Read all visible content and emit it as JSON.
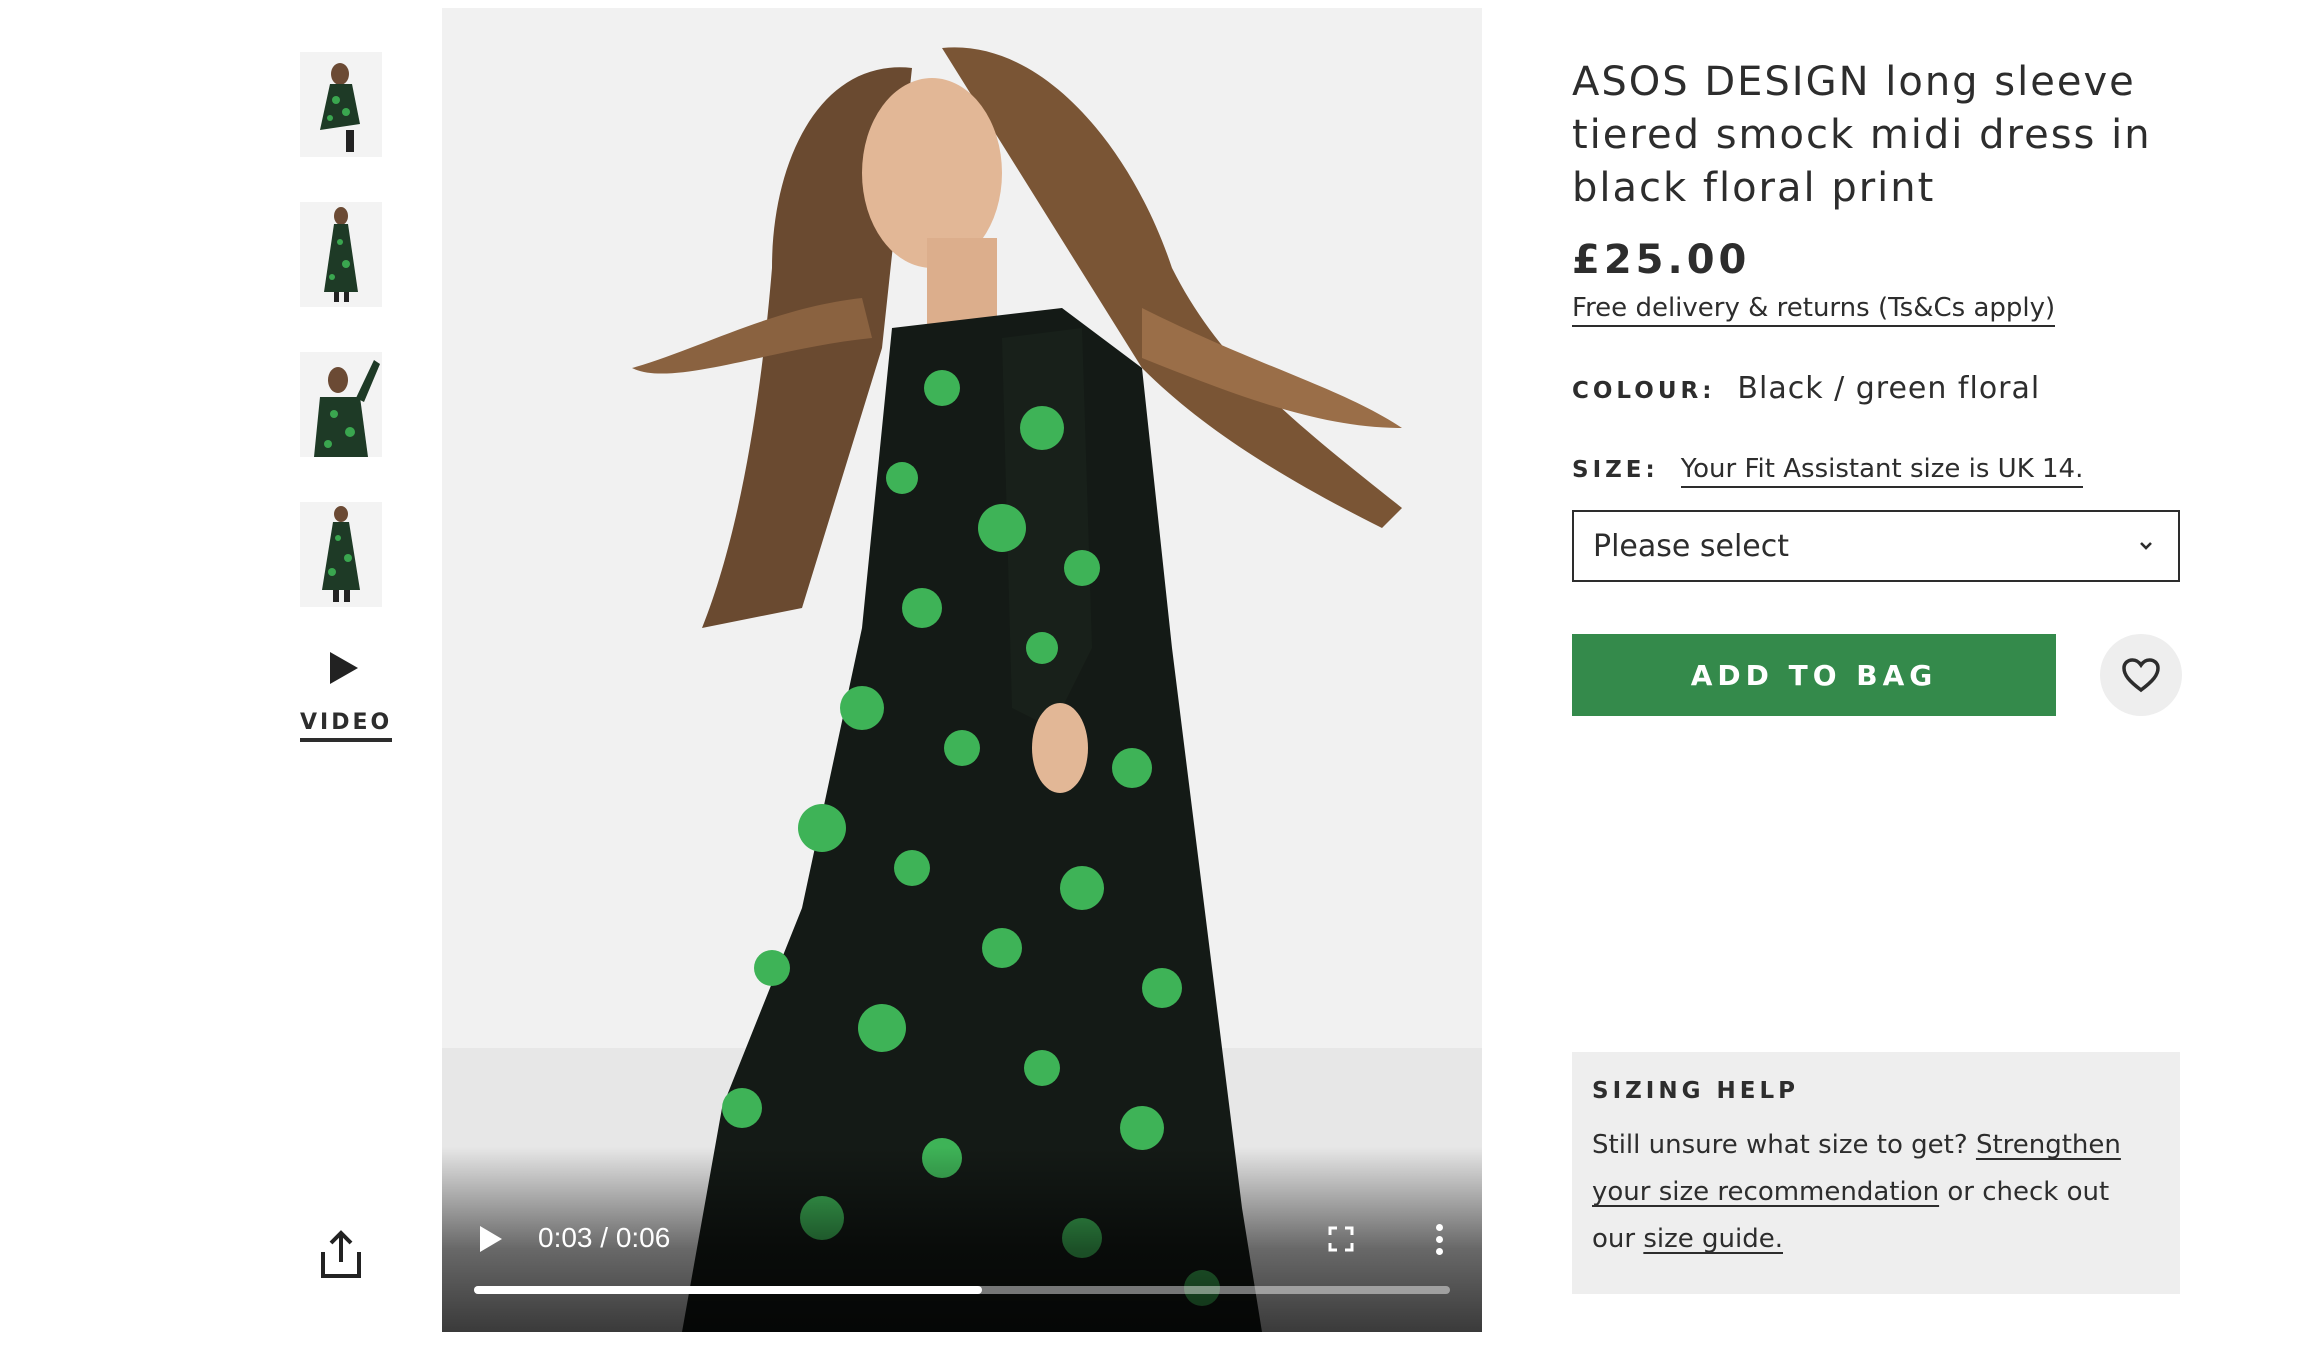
{
  "product": {
    "title": "ASOS DESIGN long sleeve tiered smock midi dress in black floral print",
    "price": "£25.00",
    "delivery_link": "Free delivery & returns (Ts&Cs apply)",
    "colour_label": "COLOUR:",
    "colour_value": "Black / green floral",
    "size_label": "SIZE:",
    "fit_assistant_link": "Your Fit Assistant size is UK 14.",
    "size_select": {
      "selected": "Please select"
    },
    "add_to_bag_label": "ADD TO BAG",
    "wishlist_icon": "heart-icon"
  },
  "gallery": {
    "thumbnail_count": 4,
    "video_label": "VIDEO",
    "share_icon": "share-icon"
  },
  "player": {
    "time_display": "0:03 / 0:06",
    "progress_fraction": 0.52,
    "icons": [
      "play-icon",
      "fullscreen-icon",
      "more-options-icon"
    ]
  },
  "sizing_help": {
    "heading": "SIZING HELP",
    "text_before": "Still unsure what size to get? ",
    "link_recommendation": "Strengthen your size recommendation",
    "text_middle": " or check out our ",
    "link_guide": "size guide."
  },
  "colors": {
    "add_to_bag": "#348a4b",
    "text": "#2d2d2d",
    "panel_background": "#eeeeee"
  }
}
